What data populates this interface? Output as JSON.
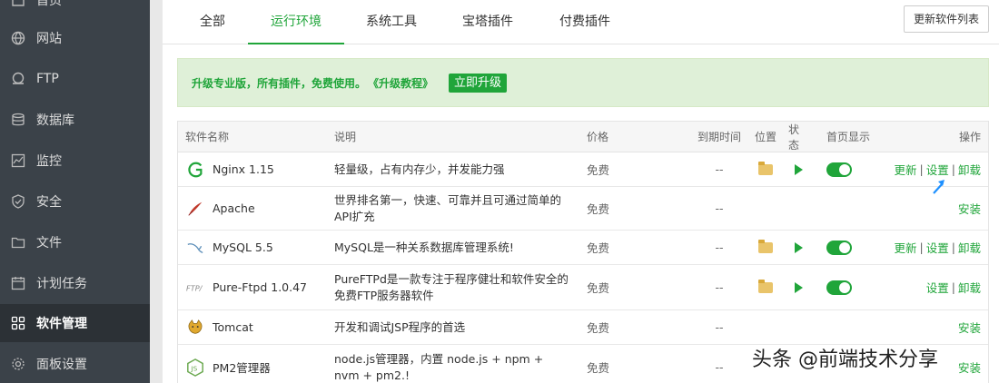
{
  "sidebar": {
    "items": [
      {
        "label": "首页",
        "icon": "home-icon"
      },
      {
        "label": "网站",
        "icon": "globe-icon"
      },
      {
        "label": "FTP",
        "icon": "ftp-icon"
      },
      {
        "label": "数据库",
        "icon": "database-icon"
      },
      {
        "label": "监控",
        "icon": "monitor-icon"
      },
      {
        "label": "安全",
        "icon": "shield-icon"
      },
      {
        "label": "文件",
        "icon": "folder-icon"
      },
      {
        "label": "计划任务",
        "icon": "calendar-icon"
      },
      {
        "label": "软件管理",
        "icon": "grid-icon"
      },
      {
        "label": "面板设置",
        "icon": "gear-icon"
      }
    ]
  },
  "tabs": [
    "全部",
    "运行环境",
    "系统工具",
    "宝塔插件",
    "付费插件"
  ],
  "refresh_label": "更新软件列表",
  "banner": {
    "text": "升级专业版，所有插件，免费使用。",
    "link": "《升级教程》",
    "button": "立即升级"
  },
  "table": {
    "headers": {
      "name": "软件名称",
      "desc": "说明",
      "price": "价格",
      "expire": "到期时间",
      "position": "位置",
      "state": "状态",
      "home": "首页显示",
      "ops": "操作"
    },
    "rows": [
      {
        "name": "Nginx 1.15",
        "desc": "轻量级，占有内存少，并发能力强",
        "price": "免费",
        "expire": "--",
        "ops": [
          "更新",
          "设置",
          "卸载"
        ]
      },
      {
        "name": "Apache",
        "desc": "世界排名第一，快速、可靠并且可通过简单的API扩充",
        "price": "免费",
        "expire": "--",
        "ops": [
          "安装"
        ]
      },
      {
        "name": "MySQL 5.5",
        "desc": "MySQL是一种关系数据库管理系统!",
        "price": "免费",
        "expire": "--",
        "ops": [
          "更新",
          "设置",
          "卸载"
        ]
      },
      {
        "name": "Pure-Ftpd 1.0.47",
        "desc": "PureFTPd是一款专注于程序健壮和软件安全的免费FTP服务器软件",
        "price": "免费",
        "expire": "--",
        "ops": [
          "设置",
          "卸载"
        ]
      },
      {
        "name": "Tomcat",
        "desc": "开发和调试JSP程序的首选",
        "price": "免费",
        "expire": "--",
        "ops": [
          "安装"
        ]
      },
      {
        "name": "PM2管理器",
        "desc": "node.js管理器，内置 node.js + npm + nvm + pm2.!",
        "price": "免费",
        "expire": "--",
        "ops": [
          "安装"
        ]
      }
    ]
  },
  "watermark": "头条 @前端技术分享",
  "colors": {
    "accent": "#20a53a",
    "sidebar": "#3b4249"
  }
}
